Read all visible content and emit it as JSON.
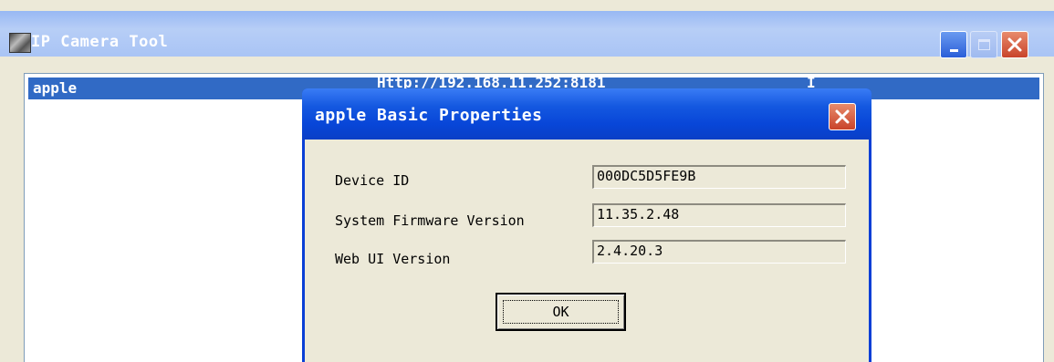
{
  "window": {
    "title": "IP Camera Tool",
    "icon": "camera-app-icon",
    "controls": [
      "minimize-icon",
      "maximize-icon",
      "close-icon"
    ]
  },
  "camera_list": {
    "rows": [
      {
        "name": "apple",
        "url": "Http://192.168.11.252:8181",
        "extra": "I"
      }
    ],
    "selected_row_color": "#316ac5"
  },
  "dialog": {
    "title": "apple Basic Properties",
    "properties": [
      {
        "label": "Device ID",
        "value": "000DC5D5FE9B"
      },
      {
        "label": "System Firmware Version",
        "value": "11.35.2.48"
      },
      {
        "label": "Web UI Version",
        "value": "2.4.20.3"
      }
    ],
    "ok_label": "OK"
  },
  "colors": {
    "titlebar_active": "#0a3fd6",
    "titlebar_inactive": "#a9c4f5",
    "close_button": "#c8432a",
    "window_bg": "#ece9d8"
  }
}
